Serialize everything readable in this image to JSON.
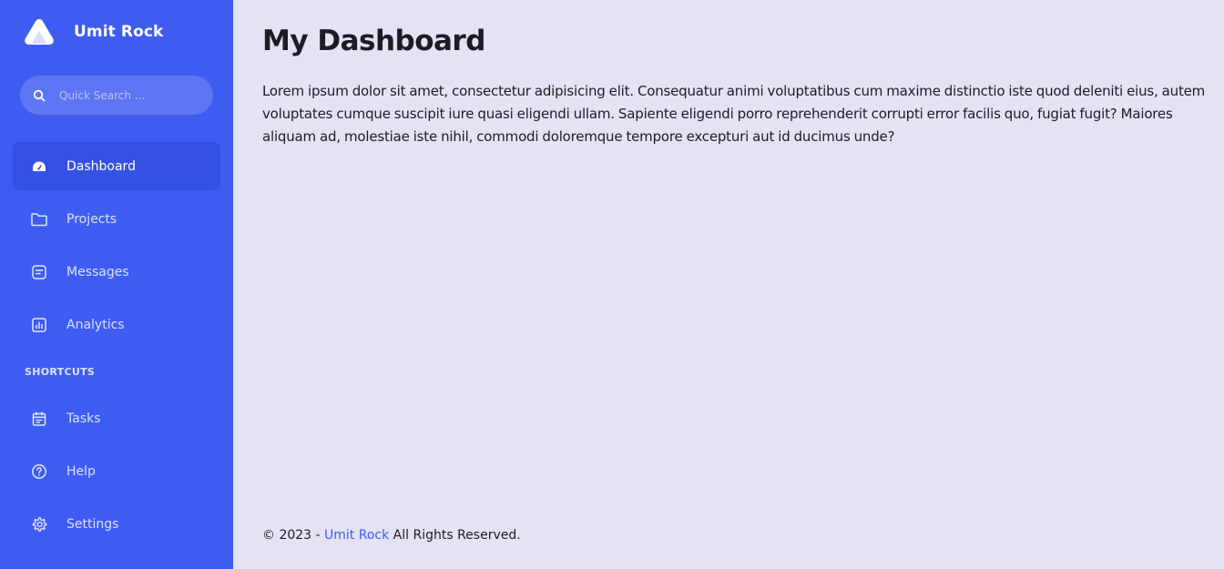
{
  "brand": {
    "name": "Umit Rock",
    "logo_icon": "triangle-logo-icon"
  },
  "search": {
    "placeholder": "Quick Search ...",
    "value": ""
  },
  "nav": {
    "items": [
      {
        "label": "Dashboard",
        "icon": "gauge-icon",
        "active": true
      },
      {
        "label": "Projects",
        "icon": "folder-icon",
        "active": false
      },
      {
        "label": "Messages",
        "icon": "message-icon",
        "active": false
      },
      {
        "label": "Analytics",
        "icon": "bar-chart-icon",
        "active": false
      }
    ],
    "shortcuts_title": "SHORTCUTS",
    "shortcuts": [
      {
        "label": "Tasks",
        "icon": "calendar-icon"
      },
      {
        "label": "Help",
        "icon": "help-icon"
      },
      {
        "label": "Settings",
        "icon": "gear-icon"
      }
    ]
  },
  "main": {
    "title": "My Dashboard",
    "text": "Lorem ipsum dolor sit amet, consectetur adipisicing elit. Consequatur animi voluptatibus cum maxime distinctio iste quod deleniti eius, autem voluptates cumque suscipit iure quasi eligendi ullam. Sapiente eligendi porro reprehenderit corrupti error facilis quo, fugiat fugit? Maiores aliquam ad, molestiae iste nihil, commodi doloremque tempore excepturi aut id ducimus unde?"
  },
  "footer": {
    "prefix": "© 2023 - ",
    "link": "Umit Rock",
    "suffix": " All Rights Reserved."
  },
  "colors": {
    "sidebar": "#3e5cf1",
    "sidebar_active": "#3451e3",
    "background": "#e4e3f4",
    "link": "#3e5cf1"
  }
}
